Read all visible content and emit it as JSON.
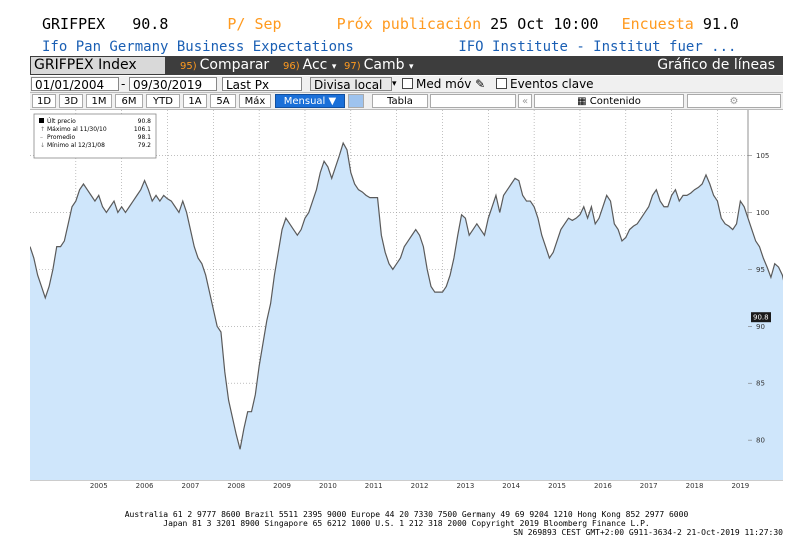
{
  "header": {
    "ticker": "GRIFPEX",
    "value": "90.8",
    "period": "P/ Sep",
    "next_pub_label": "Próx publicación",
    "next_pub_date": "25 Oct 10:00",
    "survey_label": "Encuesta",
    "survey_value": "91.0",
    "description": "Ifo Pan Germany Business Expectations",
    "source": "IFO Institute - Institut fuer ..."
  },
  "toolbar": {
    "security": "GRIFPEX Index",
    "compare_num": "95)",
    "compare_label": "Comparar",
    "actions_num": "96)",
    "actions_label": "Acc",
    "change_num": "97)",
    "change_label": "Camb",
    "chart_type": "Gráfico de líneas"
  },
  "settings": {
    "start_date": "01/01/2004",
    "dash": "-",
    "end_date": "09/30/2019",
    "price_field": "Last Px",
    "currency": "Divisa local",
    "moving_avg": "Med móv",
    "key_events": "Eventos clave"
  },
  "ranges": {
    "buttons": [
      "1D",
      "3D",
      "1M",
      "6M",
      "YTD",
      "1A",
      "5A",
      "Máx"
    ],
    "frequency": "Mensual ▼",
    "table": "Tabla",
    "content": "Contenido"
  },
  "legend": {
    "last_label": "Últ precio",
    "last_value": "90.8",
    "max_label": "Máximo al 11/30/10",
    "max_value": "106.1",
    "avg_label": "Promedio",
    "avg_value": "98.1",
    "min_label": "Mínimo al 12/31/08",
    "min_value": "79.2"
  },
  "footer": {
    "line1": "Australia 61 2 9777 8600 Brazil 5511 2395 9000 Europe 44 20 7330 7500 Germany 49 69 9204 1210 Hong Kong 852 2977 6000",
    "line2": "Japan 81 3 3201 8900        Singapore 65 6212 1000        U.S. 1 212 318 2000             Copyright 2019 Bloomberg Finance L.P.",
    "line3": "SN 269893 CEST GMT+2:00 G911-3634-2 21-Oct-2019 11:27:30"
  },
  "colors": {
    "area_fill": "#cfe6fb",
    "line": "#5a5a5a",
    "orange": "#ff9a1f",
    "blue_text": "#1a5fb4",
    "selected": "#1a6fd8"
  },
  "chart_data": {
    "type": "area",
    "x_start": "2004-01",
    "x_end": "2019-09",
    "frequency": "monthly",
    "ylim": [
      76.5,
      109
    ],
    "yticks": [
      80,
      85,
      90,
      95,
      100,
      105
    ],
    "xticks": [
      "2005",
      "2006",
      "2007",
      "2008",
      "2009",
      "2010",
      "2011",
      "2012",
      "2013",
      "2014",
      "2015",
      "2016",
      "2017",
      "2018",
      "2019"
    ],
    "last_value_label": "90.8",
    "grid": true,
    "series": [
      {
        "values": [
          97.0,
          96.0,
          94.5,
          93.5,
          92.5,
          93.5,
          95.0,
          97.0,
          97.0,
          97.5,
          99.0,
          100.5,
          101.0,
          102.0,
          102.5,
          102.0,
          101.5,
          101.0,
          101.5,
          100.5,
          100.0,
          100.5,
          101.0,
          100.0,
          100.5,
          100.0,
          100.5,
          101.0,
          101.5,
          102.0,
          102.8,
          102.0,
          101.0,
          101.5,
          101.0,
          101.5,
          101.2,
          101.0,
          100.5,
          100.0,
          101.0,
          100.0,
          98.5,
          97.0,
          96.0,
          95.5,
          94.5,
          93.0,
          91.5,
          90.0,
          89.5,
          86.0,
          83.5,
          82.0,
          80.5,
          79.2,
          81.0,
          82.5,
          82.5,
          84.0,
          86.5,
          88.5,
          90.5,
          92.0,
          94.5,
          96.5,
          98.5,
          99.5,
          99.0,
          98.5,
          98.0,
          98.5,
          99.5,
          100.0,
          101.0,
          102.0,
          103.5,
          104.5,
          104.0,
          103.0,
          104.0,
          105.0,
          106.1,
          105.5,
          103.5,
          102.5,
          102.0,
          101.8,
          101.5,
          101.3,
          101.3,
          101.3,
          98.0,
          96.5,
          95.5,
          95.0,
          95.5,
          96.0,
          97.0,
          97.5,
          98.0,
          98.5,
          98.0,
          97.0,
          95.0,
          93.5,
          93.0,
          93.0,
          93.0,
          93.5,
          94.5,
          96.0,
          98.0,
          99.8,
          99.5,
          98.0,
          98.5,
          99.0,
          98.5,
          98.0,
          99.5,
          100.5,
          101.5,
          100.0,
          101.5,
          102.0,
          102.5,
          103.0,
          102.8,
          101.5,
          101.0,
          101.0,
          100.5,
          99.5,
          98.0,
          97.0,
          96.0,
          96.5,
          97.5,
          98.5,
          99.0,
          99.5,
          99.3,
          99.5,
          99.8,
          100.5,
          99.5,
          100.5,
          99.0,
          99.5,
          100.5,
          101.5,
          101.0,
          99.0,
          98.5,
          97.5,
          97.8,
          98.5,
          98.8,
          99.0,
          99.5,
          100.0,
          100.5,
          101.5,
          102.0,
          101.0,
          100.5,
          100.5,
          101.5,
          102.0,
          101.0,
          101.5,
          101.5,
          101.7,
          102.0,
          102.2,
          102.5,
          103.3,
          102.5,
          101.5,
          101.0,
          99.5,
          99.0,
          98.8,
          98.5,
          99.0,
          101.0,
          100.5,
          99.5,
          98.5,
          97.5,
          97.0,
          96.0,
          95.2,
          94.3,
          95.5,
          95.2,
          94.5,
          93.0,
          92.0,
          91.3,
          90.8
        ]
      }
    ]
  }
}
